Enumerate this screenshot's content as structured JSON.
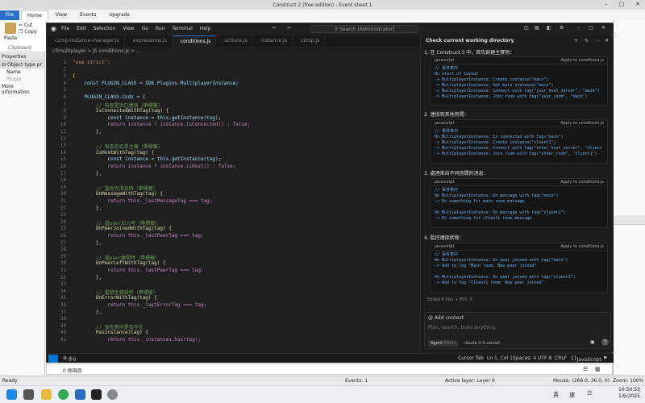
{
  "construct": {
    "title": "Construct 2  (free edition) - Event sheet 1",
    "ribbon_tabs": [
      "File",
      "Home",
      "View",
      "Events",
      "Upgrade"
    ],
    "paste_label": "Paste",
    "cut_label": "Cut",
    "copy_label": "Copy",
    "clipboard_label": "Clipboard",
    "left_panel": {
      "header": "Properties",
      "group": "Object type pr",
      "name_label": "Name",
      "plugin_label": "Plugin",
      "more": "More information"
    },
    "status": {
      "ready": "Ready",
      "events": "Events: 1",
      "active_layer": "Active layer: Layer 0",
      "mouse": "Mouse: (266.0, 36.0, 0)",
      "zoom": "Zoom: 100%"
    }
  },
  "vscode": {
    "menu": [
      "File",
      "Edit",
      "Selection",
      "View",
      "Go",
      "Run",
      "Terminal",
      "Help"
    ],
    "search_placeholder": "Search [Administrator]",
    "tabs": [
      {
        "label": "c2mp-instance-manager.js",
        "active": false
      },
      {
        "label": "expressions.js",
        "active": false
      },
      {
        "label": "conditions.js",
        "active": true
      },
      {
        "label": "actions.js",
        "active": false
      },
      {
        "label": "instance.js",
        "active": false
      },
      {
        "label": "c2mp.js",
        "active": false
      }
    ],
    "breadcrumb": "c3multiplayer > JS conditions.js > ...",
    "code_lines": [
      {
        "n": "1",
        "t": "\"use strict\";",
        "c": "#ce9178"
      },
      {
        "n": "2",
        "t": "",
        "c": "#ccc"
      },
      {
        "n": "3",
        "t": "{",
        "c": "#ffd700"
      },
      {
        "n": "4",
        "t": "    const PLUGIN_CLASS = SDK.Plugins.MultiplayerInstance;",
        "c": "#9cdcfe"
      },
      {
        "n": "5",
        "t": "",
        "c": "#ccc"
      },
      {
        "n": "6",
        "t": "    PLUGIN_CLASS.Cnds = {",
        "c": "#9cdcfe"
      },
      {
        "n": "7",
        "t": "        // 檢查是否已連接（帶標籤）",
        "c": "#6a9955"
      },
      {
        "n": "8",
        "t": "        IsConnectedWithTag(tag) {",
        "c": "#dcdcaa"
      },
      {
        "n": "9",
        "t": "            const instance = this.getInstance(tag);",
        "c": "#9cdcfe"
      },
      {
        "n": "10",
        "t": "            return instance ? instance.isConnected() : false;",
        "c": "#c586c0"
      },
      {
        "n": "11",
        "t": "        },",
        "c": "#ccc"
      },
      {
        "n": "12",
        "t": "",
        "c": "#ccc"
      },
      {
        "n": "13",
        "t": "        // 檢查是否是主機（帶標籤）",
        "c": "#6a9955"
      },
      {
        "n": "14",
        "t": "        IsHostWithTag(tag) {",
        "c": "#dcdcaa"
      },
      {
        "n": "15",
        "t": "            const instance = this.getInstance(tag);",
        "c": "#9cdcfe"
      },
      {
        "n": "16",
        "t": "            return instance ? instance.isHost() : false;",
        "c": "#c586c0"
      },
      {
        "n": "17",
        "t": "        },",
        "c": "#ccc"
      },
      {
        "n": "18",
        "t": "",
        "c": "#ccc"
      },
      {
        "n": "19",
        "t": "        // 當收到消息時（帶標籤）",
        "c": "#6a9955"
      },
      {
        "n": "20",
        "t": "        OnMessageWithTag(tag) {",
        "c": "#dcdcaa"
      },
      {
        "n": "21",
        "t": "            return this._lastMessageTag === tag;",
        "c": "#c586c0"
      },
      {
        "n": "22",
        "t": "        },",
        "c": "#ccc"
      },
      {
        "n": "23",
        "t": "",
        "c": "#ccc"
      },
      {
        "n": "24",
        "t": "        // 當peer加入時（帶標籤）",
        "c": "#6a9955"
      },
      {
        "n": "25",
        "t": "        OnPeerJoinedWithTag(tag) {",
        "c": "#dcdcaa"
      },
      {
        "n": "26",
        "t": "            return this._lastPeerTag === tag;",
        "c": "#c586c0"
      },
      {
        "n": "27",
        "t": "        },",
        "c": "#ccc"
      },
      {
        "n": "28",
        "t": "",
        "c": "#ccc"
      },
      {
        "n": "29",
        "t": "        // 當peer離開時（帶標籤）",
        "c": "#6a9955"
      },
      {
        "n": "30",
        "t": "        OnPeerLeftWithTag(tag) {",
        "c": "#dcdcaa"
      },
      {
        "n": "31",
        "t": "            return this._lastPeerTag === tag;",
        "c": "#c586c0"
      },
      {
        "n": "32",
        "t": "        },",
        "c": "#ccc"
      },
      {
        "n": "33",
        "t": "",
        "c": "#ccc"
      },
      {
        "n": "34",
        "t": "        // 當發生錯誤時（帶標籤）",
        "c": "#6a9955"
      },
      {
        "n": "35",
        "t": "        OnErrorWithTag(tag) {",
        "c": "#dcdcaa"
      },
      {
        "n": "36",
        "t": "            return this._lastErrorTag === tag;",
        "c": "#c586c0"
      },
      {
        "n": "37",
        "t": "        },",
        "c": "#ccc"
      },
      {
        "n": "38",
        "t": "",
        "c": "#ccc"
      },
      {
        "n": "39",
        "t": "        // 檢查實例是否存在",
        "c": "#6a9955"
      },
      {
        "n": "40",
        "t": "        HasInstance(tag) {",
        "c": "#dcdcaa"
      },
      {
        "n": "41",
        "t": "            return this._instances.has(tag);",
        "c": "#c586c0"
      }
    ],
    "chat": {
      "header": "Check current working directory",
      "steps": [
        {
          "title": "1. 在 Construct 3 中，首先創建主實例：",
          "lang": "javascript",
          "apply": "Apply to conditions.js",
          "code": "// 事件表中\nOn start of layout\n-> MultiplayerInstance: Create instance(\"main\")\n-> MultiplayerInstance: Set main instance(\"main\")\n-> MultiplayerInstance: Connect with tag(\"your_host_server\", \"main\")\n-> MultiplayerInstance: Join room with tag(\"your_room\", \"main\")"
        },
        {
          "title": "2. 連接到其他房間：",
          "lang": "javascript",
          "apply": "Apply to conditions.js",
          "code": "// 事件表中\nOn MultiplayerInstance: Is connected with tag(\"main\")\n-> MultiplayerInstance: Create instance(\"client1\")\n-> MultiplayerInstance: Connect with tag(\"other_host_server\", \"client\n-> MultiplayerInstance: Join room with tag(\"other_room\", \"client1\")"
        },
        {
          "title": "3. 處理來自不同房間的消息：",
          "lang": "javascript",
          "apply": "Apply to conditions.js",
          "code": "// 事件表中\nOn MultiplayerInstance: On message with tag(\"main\")\n-> Do something for main room message\n\nOn MultiplayerInstance: On message with tag(\"client1\")\n-> Do something for client1 room message"
        },
        {
          "title": "4. 監控連接狀態：",
          "lang": "javascript",
          "apply": "Apply to conditions.js",
          "code": "// 事件表中\nOn MultiplayerInstance: On peer joined with tag(\"main\")\n-> Add to log \"Main room: New peer joined\"\n\nOn MultiplayerInstance: On peer joined with tag(\"client1\")\n-> Add to log \"Client1 room: New peer joined\""
        }
      ],
      "edited": "Edited 6 files + 855 -5",
      "add_context": "Add context",
      "input_placeholder": "Plan, search, build anything",
      "agent_label": "Agent",
      "agent_shortcut": "Ctrl+I",
      "model": "claude-3.5-sonnet"
    },
    "status": {
      "errors": "0",
      "warnings": "0",
      "cursor_tab": "Cursor Tab",
      "position": "Ln 1, Col 1",
      "spaces": "Spaces: 4",
      "encoding": "UTF-8",
      "eol": "CRLF",
      "language": "JavaScript"
    },
    "footer_count": "0 個項目"
  },
  "tray": {
    "time": "10:50:53",
    "date": "1/6/2025",
    "lang1": "英",
    "lang2": "速"
  }
}
